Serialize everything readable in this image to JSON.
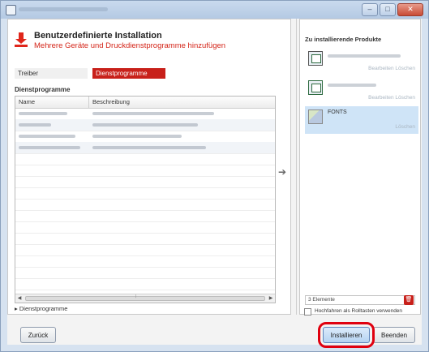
{
  "header": {
    "title": "Benutzerdefinierte Installation",
    "subtitle": "Mehrere Geräte und Druckdienstprogramme hinzufügen"
  },
  "tabs": [
    {
      "label": "Treiber"
    },
    {
      "label": "Dienstprogramme"
    }
  ],
  "utilities": {
    "section_label": "Dienstprogramme",
    "columns": [
      "Name",
      "Beschreibung"
    ],
    "expander_label": "Dienstprogramme"
  },
  "right_panel": {
    "title": "Zu installierende Produkte",
    "items": [
      {
        "name": "",
        "links": "Bearbeiten  Löschen"
      },
      {
        "name": "",
        "links": "Bearbeiten  Löschen"
      },
      {
        "name": "FONTS",
        "links": "Löschen"
      }
    ],
    "count_text": "3 Elemente",
    "checkbox_label": "Hochfahren als Rolltasten verwenden"
  },
  "buttons": {
    "back": "Zurück",
    "install": "Installieren",
    "finish": "Beenden"
  },
  "colors": {
    "accent": "#c8201a",
    "highlight": "#e0000f",
    "selection": "#cfe4f7"
  }
}
